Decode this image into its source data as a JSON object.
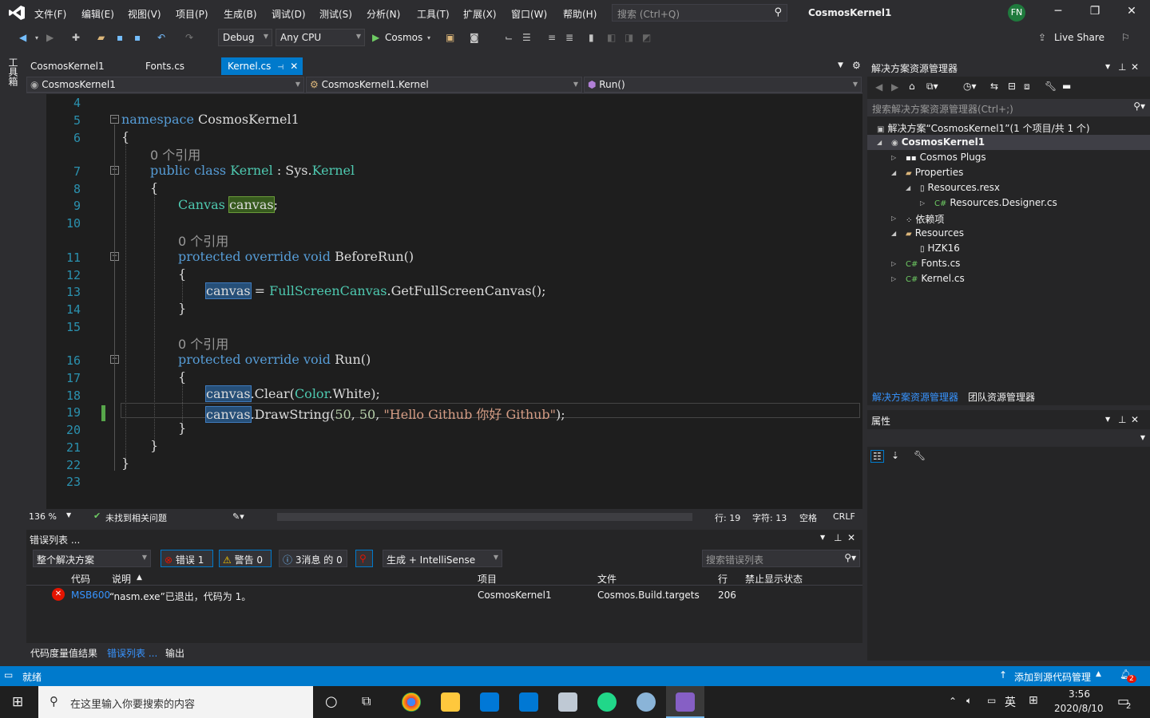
{
  "titlebar": {
    "menus": [
      "文件(F)",
      "编辑(E)",
      "视图(V)",
      "项目(P)",
      "生成(B)",
      "调试(D)",
      "测试(S)",
      "分析(N)",
      "工具(T)",
      "扩展(X)",
      "窗口(W)",
      "帮助(H)"
    ],
    "search_placeholder": "搜索 (Ctrl+Q)",
    "project_title": "CosmosKernel1",
    "avatar": "FN",
    "window_controls": [
      "─",
      "❐",
      "✕"
    ]
  },
  "toolbar": {
    "config": "Debug",
    "platform": "Any CPU",
    "run_label": "Cosmos",
    "live_share": "Live Share"
  },
  "sidebar": {
    "toolbox_label": "工具箱"
  },
  "tabs": [
    {
      "label": "CosmosKernel1",
      "active": false
    },
    {
      "label": "Fonts.cs",
      "active": false
    },
    {
      "label": "Kernel.cs",
      "active": true
    }
  ],
  "navbar": {
    "project": "CosmosKernel1",
    "class": "CosmosKernel1.Kernel",
    "member": "Run()"
  },
  "editor": {
    "line_numbers": [
      "4",
      "5",
      "6",
      "7",
      "8",
      "9",
      "10",
      "11",
      "12",
      "13",
      "14",
      "15",
      "16",
      "17",
      "18",
      "19",
      "20",
      "21",
      "22",
      "23"
    ],
    "refs": "0 个引用",
    "namespace_kw": "namespace",
    "namespace_name": "CosmosKernel1",
    "public_class": "public class",
    "class_name": "Kernel",
    "colon": " : ",
    "sys": "Sys.",
    "base_kernel": "Kernel",
    "canvas_type": "Canvas",
    "canvas_var": "canvas",
    "protected_override_void": "protected override void",
    "before_run": "BeforeRun()",
    "assign": " = ",
    "fsc": "FullScreenCanvas",
    "get_fsc": ".GetFullScreenCanvas();",
    "run": "Run()",
    "clear_call": ".Clear(",
    "color": "Color",
    "white": ".White);",
    "draw_call": ".DrawString(",
    "num50": "50",
    "comma": ", ",
    "string_lit": "\"Hello Github 你好 Github\"",
    "close": ");",
    "brace_open": "{",
    "brace_close": "}",
    "semicolon": ";"
  },
  "editor_status": {
    "zoom": "136 %",
    "issues": "未找到相关问题",
    "line": "行: 19",
    "col": "字符: 13",
    "spaces": "空格",
    "eol": "CRLF"
  },
  "error_list": {
    "title": "错误列表 ...",
    "scope": "整个解决方案",
    "errors": "错误 1",
    "warnings": "警告 0",
    "messages": "3消息 的 0",
    "build_filter": "生成 + IntelliSense",
    "search_placeholder": "搜索错误列表",
    "columns": [
      "代码",
      "说明",
      "项目",
      "文件",
      "行",
      "禁止显示状态"
    ],
    "rows": [
      {
        "code": "MSB600",
        "desc": "“nasm.exe”已退出，代码为 1。",
        "project": "CosmosKernel1",
        "file": "Cosmos.Build.targets",
        "line": "206",
        "suppression": ""
      }
    ]
  },
  "bottom_tabs": [
    "代码度量值结果",
    "错误列表 ...",
    "输出"
  ],
  "solution_explorer": {
    "title": "解决方案资源管理器",
    "search_placeholder": "搜索解决方案资源管理器(Ctrl+;)",
    "items": [
      {
        "label": "解决方案“CosmosKernel1”(1 个项目/共 1 个)",
        "bold": false
      },
      {
        "label": "CosmosKernel1",
        "bold": true
      },
      {
        "label": "Cosmos Plugs",
        "bold": false
      },
      {
        "label": "Properties",
        "bold": false
      },
      {
        "label": "Resources.resx",
        "bold": false
      },
      {
        "label": "Resources.Designer.cs",
        "bold": false
      },
      {
        "label": "依赖项",
        "bold": false
      },
      {
        "label": "Resources",
        "bold": false
      },
      {
        "label": "HZK16",
        "bold": false
      },
      {
        "label": "Fonts.cs",
        "bold": false
      },
      {
        "label": "Kernel.cs",
        "bold": false
      }
    ],
    "bottom_tabs": [
      "解决方案资源管理器",
      "团队资源管理器"
    ]
  },
  "properties": {
    "title": "属性"
  },
  "statusbar": {
    "ready": "就绪",
    "source_control": "添加到源代码管理",
    "notifications": "2"
  },
  "taskbar": {
    "search_placeholder": "在这里输入你要搜索的内容",
    "time": "3:56",
    "date": "2020/8/10",
    "ime": "英",
    "notif_count": "2"
  }
}
